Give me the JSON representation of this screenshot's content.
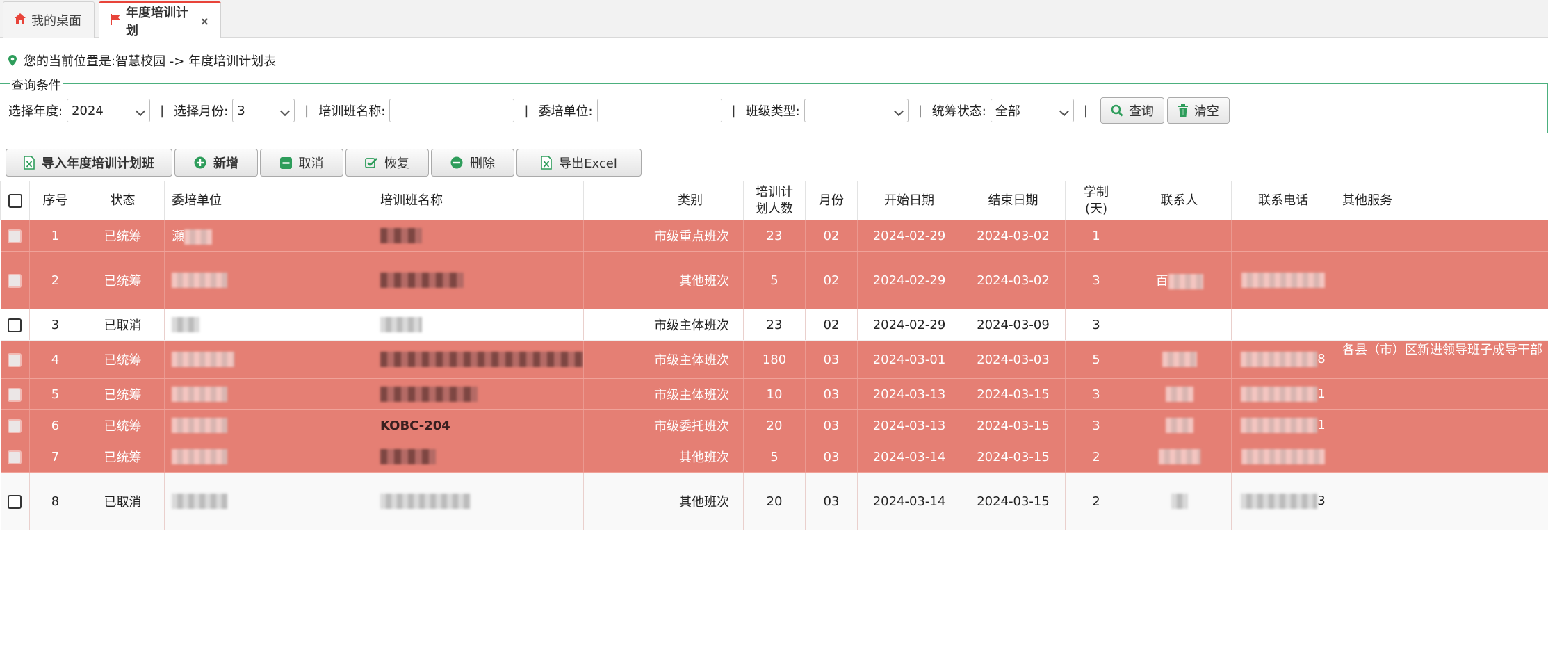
{
  "tabs": [
    {
      "label": "我的桌面",
      "icon": "home-icon",
      "active": false
    },
    {
      "label": "年度培训计划",
      "icon": "flag-icon",
      "active": true,
      "close": "×"
    }
  ],
  "breadcrumb": {
    "text": "您的当前位置是:智慧校园 -> 年度培训计划表",
    "icon": "map-pin-icon"
  },
  "query": {
    "legend": "查询条件",
    "year_label": "选择年度:",
    "year_value": "2024",
    "month_label": "选择月份:",
    "month_value": "3",
    "class_name_label": "培训班名称:",
    "class_name_value": "",
    "unit_label": "委培单位:",
    "unit_value": "",
    "class_type_label": "班级类型:",
    "class_type_value": "",
    "status_label": "统筹状态:",
    "status_value": "全部",
    "separator": "|",
    "search_label": "查询",
    "clear_label": "清空"
  },
  "toolbar": {
    "import_label": "导入年度培训计划班",
    "add_label": "新增",
    "cancel_label": "取消",
    "restore_label": "恢复",
    "delete_label": "删除",
    "export_label": "导出Excel"
  },
  "table": {
    "headers": {
      "seq": "序号",
      "status": "状态",
      "unit": "委培单位",
      "class_name": "培训班名称",
      "category": "类别",
      "plan_count_1": "培训计",
      "plan_count_2": "划人数",
      "month": "月份",
      "start": "开始日期",
      "end": "结束日期",
      "duration_1": "学制",
      "duration_2": "(天)",
      "contact": "联系人",
      "phone": "联系电话",
      "other": "其他服务"
    },
    "rows": [
      {
        "seq": "1",
        "status": "已统筹",
        "unit_frag": "瀬",
        "name_frag": "",
        "category": "市级重点班次",
        "count": "23",
        "month": "02",
        "start": "2024-02-29",
        "end": "2024-03-02",
        "days": "1",
        "contact_frag": "",
        "phone_frag": "",
        "other": ""
      },
      {
        "seq": "2",
        "status": "已统筹",
        "unit_frag": "",
        "name_frag": "",
        "category": "其他班次",
        "count": "5",
        "month": "02",
        "start": "2024-02-29",
        "end": "2024-03-02",
        "days": "3",
        "contact_frag": "百",
        "phone_frag": "",
        "other": ""
      },
      {
        "seq": "3",
        "status": "已取消",
        "unit_frag": "",
        "name_frag": "",
        "category": "市级主体班次",
        "count": "23",
        "month": "02",
        "start": "2024-02-29",
        "end": "2024-03-09",
        "days": "3",
        "contact_frag": "",
        "phone_frag": "",
        "other": ""
      },
      {
        "seq": "4",
        "status": "已统筹",
        "unit_frag": "",
        "name_frag": "",
        "category": "市级主体班次",
        "count": "180",
        "month": "03",
        "start": "2024-03-01",
        "end": "2024-03-03",
        "days": "5",
        "contact_frag": "",
        "phone_frag": "8",
        "other": "各县（市）区新进领导班子成导干部"
      },
      {
        "seq": "5",
        "status": "已统筹",
        "unit_frag": "",
        "name_frag": "",
        "category": "市级主体班次",
        "count": "10",
        "month": "03",
        "start": "2024-03-13",
        "end": "2024-03-15",
        "days": "3",
        "contact_frag": "",
        "phone_frag": "1",
        "other": ""
      },
      {
        "seq": "6",
        "status": "已统筹",
        "unit_frag": "",
        "name_frag": "KOBC-204",
        "category": "市级委托班次",
        "count": "20",
        "month": "03",
        "start": "2024-03-13",
        "end": "2024-03-15",
        "days": "3",
        "contact_frag": "",
        "phone_frag": "1",
        "other": ""
      },
      {
        "seq": "7",
        "status": "已统筹",
        "unit_frag": "",
        "name_frag": "",
        "category": "其他班次",
        "count": "5",
        "month": "03",
        "start": "2024-03-14",
        "end": "2024-03-15",
        "days": "2",
        "contact_frag": "",
        "phone_frag": "",
        "other": ""
      },
      {
        "seq": "8",
        "status": "已取消",
        "unit_frag": "",
        "name_frag": "",
        "category": "其他班次",
        "count": "20",
        "month": "03",
        "start": "2024-03-14",
        "end": "2024-03-15",
        "days": "2",
        "contact_frag": "",
        "phone_frag": "3",
        "other": ""
      }
    ]
  },
  "colors": {
    "highlight_row": "#e57f74",
    "tab_accent": "#e8443a",
    "fieldset_border": "#4cb07e",
    "icon_green": "#2e9d5b"
  }
}
